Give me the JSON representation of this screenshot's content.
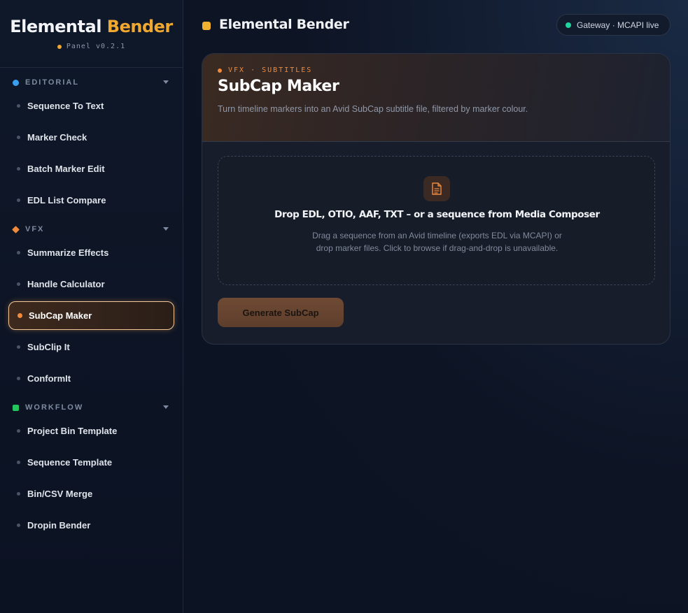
{
  "brand": {
    "title_main": "Elemental",
    "title_accent": "Bender",
    "version": "Panel v0.2.1"
  },
  "colors": {
    "accent": "#f0a830",
    "editorial": "#3b9ff0",
    "vfx": "#f08a3c",
    "workflow": "#22c55e",
    "status_live": "#22d3a0"
  },
  "sections": [
    {
      "label": "EDITORIAL",
      "items": [
        "Sequence To Text",
        "Marker Check",
        "Batch Marker Edit",
        "EDL List Compare"
      ]
    },
    {
      "label": "VFX",
      "items": [
        "Summarize Effects",
        "Handle Calculator",
        "SubCap Maker",
        "SubClip It",
        "ConformIt"
      ]
    },
    {
      "label": "WORKFLOW",
      "items": [
        "Project Bin Template",
        "Sequence Template",
        "Bin/CSV Merge",
        "Dropin Bender"
      ]
    }
  ],
  "active_item": "SubCap Maker",
  "header": {
    "title": "Elemental Bender",
    "gateway_status": "Gateway · MCAPI live"
  },
  "card": {
    "eyebrow": "VFX · SUBTITLES",
    "title": "SubCap Maker",
    "description": "Turn timeline markers into an Avid SubCap subtitle file, filtered by marker colour.",
    "dropzone": {
      "icon": "file-text-icon",
      "title": "Drop EDL, OTIO, AAF, TXT – or a sequence from Media Composer",
      "subtitle": "Drag a sequence from an Avid timeline (exports EDL via MCAPI) or drop marker files. Click to browse if drag-and-drop is unavailable."
    },
    "button_label": "Generate SubCap"
  }
}
